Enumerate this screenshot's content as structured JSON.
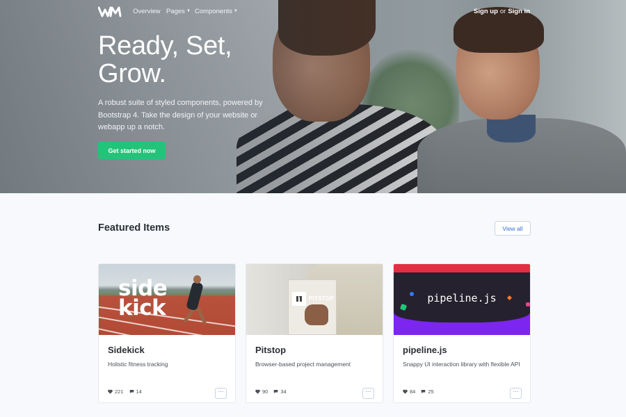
{
  "nav": {
    "links": [
      {
        "label": "Overview",
        "caret": false
      },
      {
        "label": "Pages",
        "caret": true
      },
      {
        "label": "Components",
        "caret": true
      }
    ],
    "signup": "Sign up",
    "or": "or",
    "signin": "Sign in"
  },
  "hero": {
    "title_line1": "Ready, Set,",
    "title_line2": "Grow.",
    "description": "A robust suite of styled components, powered by Bootstrap 4. Take the design of your website or webapp up a notch.",
    "cta": "Get started now"
  },
  "featured": {
    "title": "Featured Items",
    "view_all": "View all",
    "cards": [
      {
        "image_text": [
          "side",
          "kick"
        ],
        "title": "Sidekick",
        "description": "Holistic fitness tracking",
        "likes": "221",
        "comments": "14",
        "more": "···"
      },
      {
        "image_text": [
          "PITSTOP"
        ],
        "title": "Pitstop",
        "description": "Browser-based project management",
        "likes": "90",
        "comments": "34",
        "more": "···"
      },
      {
        "image_text": [
          "pipeline.js"
        ],
        "title": "pipeline.js",
        "description": "Snappy UI interaction library with flexible API",
        "likes": "84",
        "comments": "25",
        "more": "···"
      }
    ]
  },
  "colors": {
    "accent_green": "#22c47a",
    "link_blue": "#2f6fd6",
    "page_bg": "#f7f9fc"
  }
}
